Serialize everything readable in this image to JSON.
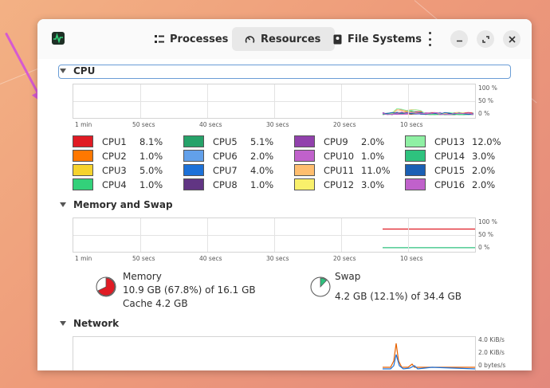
{
  "tabs": {
    "processes": "Processes",
    "resources": "Resources",
    "file_systems": "File Systems"
  },
  "cpu": {
    "title": "CPU",
    "x_ticks": [
      "1 min",
      "50 secs",
      "40 secs",
      "30 secs",
      "20 secs",
      "10 secs"
    ],
    "y_ticks": [
      "100 %",
      "50 %",
      "0 %"
    ],
    "cores": [
      {
        "name": "CPU1",
        "value": "8.1%",
        "color": "#e01b24"
      },
      {
        "name": "CPU2",
        "value": "1.0%",
        "color": "#ff7800"
      },
      {
        "name": "CPU3",
        "value": "5.0%",
        "color": "#f6d32d"
      },
      {
        "name": "CPU4",
        "value": "1.0%",
        "color": "#33d17a"
      },
      {
        "name": "CPU5",
        "value": "5.1%",
        "color": "#26a269"
      },
      {
        "name": "CPU6",
        "value": "2.0%",
        "color": "#62a0ea"
      },
      {
        "name": "CPU7",
        "value": "4.0%",
        "color": "#1c71d8"
      },
      {
        "name": "CPU8",
        "value": "1.0%",
        "color": "#613583"
      },
      {
        "name": "CPU9",
        "value": "2.0%",
        "color": "#9141ac"
      },
      {
        "name": "CPU10",
        "value": "1.0%",
        "color": "#c061cb"
      },
      {
        "name": "CPU11",
        "value": "11.0%",
        "color": "#ffbe6f"
      },
      {
        "name": "CPU12",
        "value": "3.0%",
        "color": "#f9f06b"
      },
      {
        "name": "CPU13",
        "value": "12.0%",
        "color": "#8ff0a4"
      },
      {
        "name": "CPU14",
        "value": "3.0%",
        "color": "#2ec27e"
      },
      {
        "name": "CPU15",
        "value": "2.0%",
        "color": "#1a5fb4"
      },
      {
        "name": "CPU16",
        "value": "2.0%",
        "color": "#c061cb"
      }
    ]
  },
  "memory_swap": {
    "title": "Memory and Swap",
    "x_ticks": [
      "1 min",
      "50 secs",
      "40 secs",
      "30 secs",
      "20 secs",
      "10 secs"
    ],
    "y_ticks": [
      "100 %",
      "50 %",
      "0 %"
    ],
    "memory_label": "Memory",
    "memory_value": "10.9 GB (67.8%) of 16.1 GB",
    "memory_cache": "Cache 4.2 GB",
    "memory_fraction": 0.678,
    "memory_color": "#e01b24",
    "swap_label": "Swap",
    "swap_value": "4.2 GB (12.1%) of 34.4 GB",
    "swap_fraction": 0.121,
    "swap_color": "#2ec27e"
  },
  "network": {
    "title": "Network",
    "y_ticks": [
      "4.0 KiB/s",
      "2.0 KiB/s",
      "0 bytes/s"
    ]
  }
}
